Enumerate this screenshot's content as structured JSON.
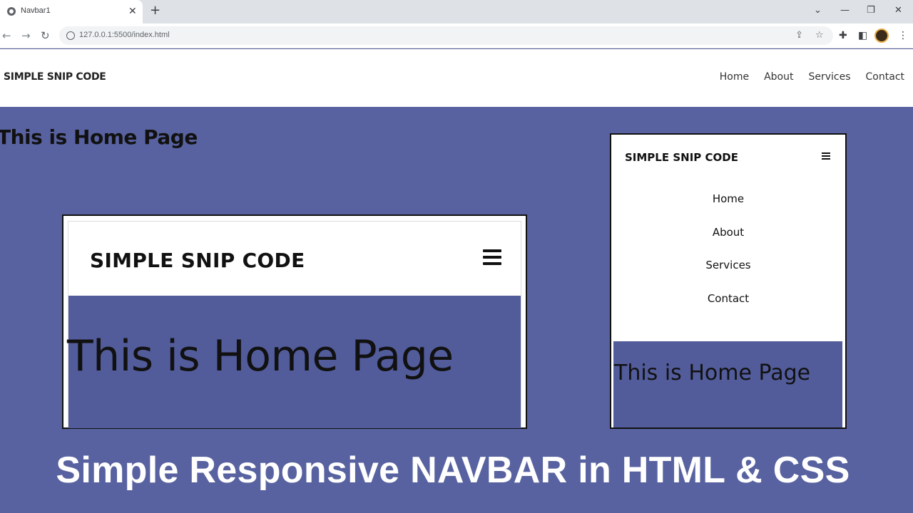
{
  "browser": {
    "tab_title": "Navbar1",
    "tab_close": "✕",
    "new_tab": "+",
    "url": "127.0.0.1:5500/index.html",
    "window_controls": [
      "⌄",
      "—",
      "❐",
      "✕"
    ],
    "icons": [
      "globe-icon",
      "back-icon",
      "forward-icon",
      "reload-icon",
      "info-icon",
      "share-icon",
      "star-icon",
      "extensions-icon",
      "sidepanel-icon",
      "profile-avatar",
      "menu-icon"
    ]
  },
  "site": {
    "logo": "SIMPLE SNIP CODE",
    "links": [
      "Home",
      "About",
      "Services",
      "Contact"
    ],
    "heading": "This is Home Page"
  },
  "mock_desktop": {
    "logo": "SIMPLE SNIP CODE",
    "heading": "This is Home Page",
    "menu_icon": "hamburger-icon"
  },
  "mock_mobile": {
    "logo": "SIMPLE SNIP CODE",
    "menu": [
      "Home",
      "About",
      "Services",
      "Contact"
    ],
    "heading": "This is Home Page",
    "menu_icon": "hamburger-icon"
  },
  "caption": "Simple Responsive NAVBAR in HTML & CSS",
  "colors": {
    "page_bg": "#5862a0",
    "content_bg": "#525c9b",
    "navbar_bg": "#ffffff",
    "caption_text": "#ffffff"
  }
}
